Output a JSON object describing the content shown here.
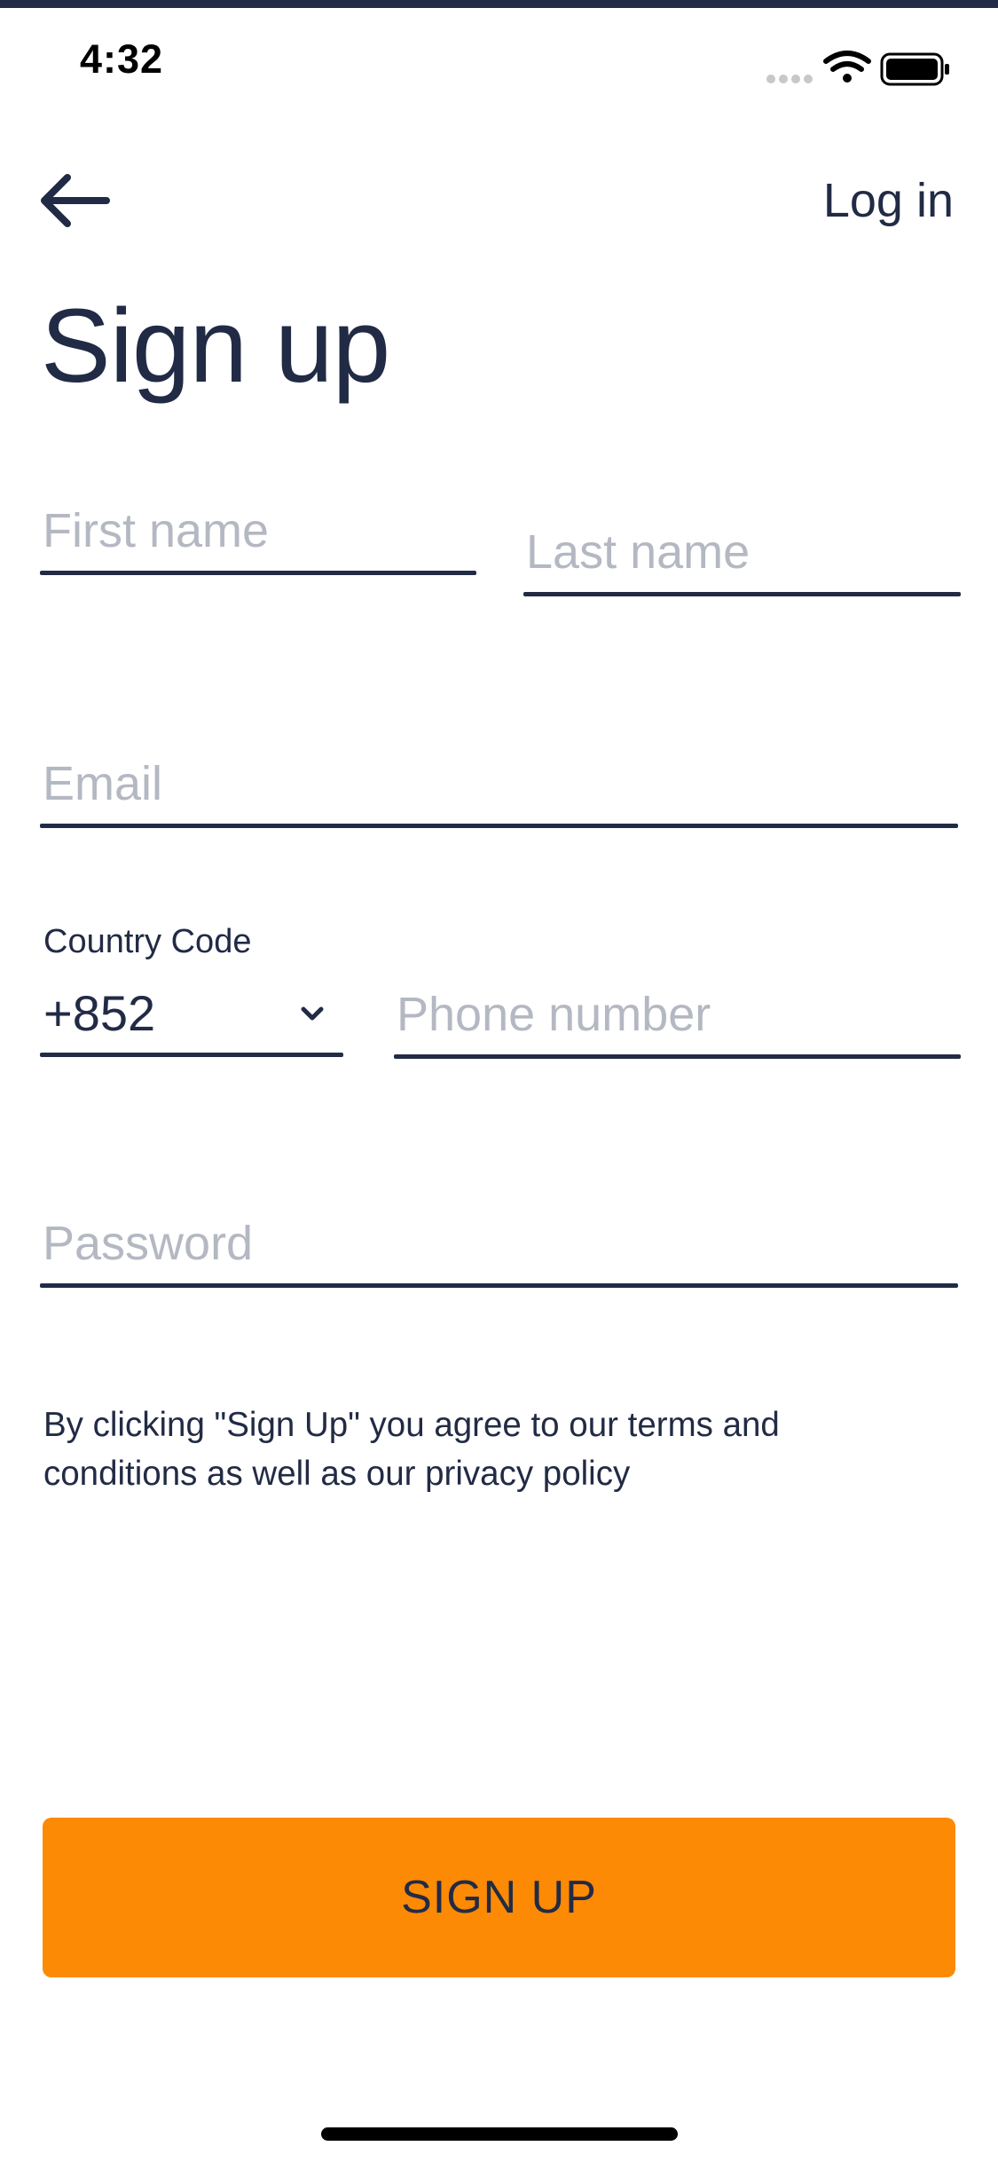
{
  "status_bar": {
    "time": "4:32",
    "icons": [
      "signal-dots-icon",
      "wifi-icon",
      "battery-icon"
    ]
  },
  "header": {
    "back_icon": "arrow-left-icon",
    "login_label": "Log in"
  },
  "title": "Sign up",
  "form": {
    "first_name": {
      "placeholder": "First name",
      "value": ""
    },
    "last_name": {
      "placeholder": "Last name",
      "value": ""
    },
    "email": {
      "placeholder": "Email",
      "value": ""
    },
    "country_code": {
      "label": "Country Code",
      "value": "+852"
    },
    "phone": {
      "placeholder": "Phone number",
      "value": ""
    },
    "password": {
      "placeholder": "Password",
      "value": ""
    }
  },
  "terms_text": "By clicking \"Sign Up\" you agree to our terms and conditions as well as our privacy policy",
  "signup_button_label": "SIGN UP",
  "colors": {
    "primary_text": "#222b45",
    "placeholder": "#b4b8c2",
    "accent_button": "#fd8a04",
    "background": "#ffffff"
  }
}
